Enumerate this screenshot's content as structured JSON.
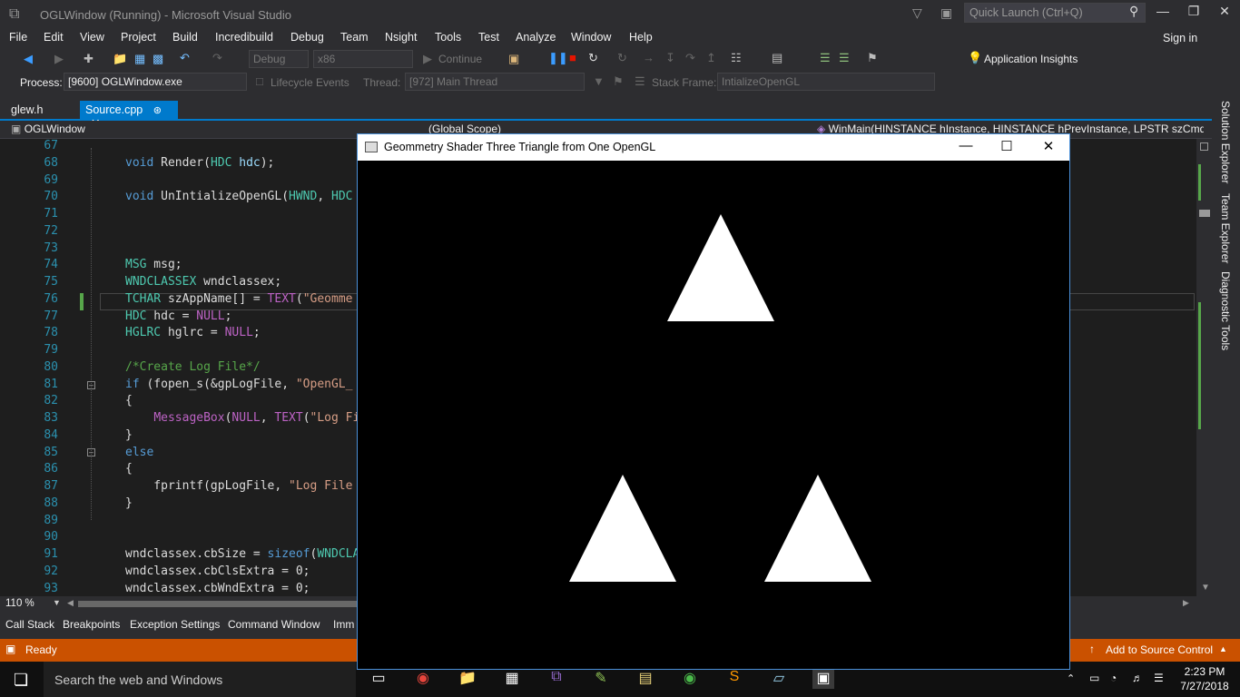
{
  "window": {
    "title": "OGLWindow (Running) - Microsoft Visual Studio",
    "quick_launch_placeholder": "Quick Launch (Ctrl+Q)"
  },
  "menu": [
    "File",
    "Edit",
    "View",
    "Project",
    "Build",
    "Incredibuild",
    "Debug",
    "Team",
    "Nsight",
    "Tools",
    "Test",
    "Analyze",
    "Window",
    "Help"
  ],
  "sign_in": "Sign in",
  "toolbar": {
    "config": "Debug",
    "platform": "x86",
    "continue": "Continue",
    "app_insights": "Application Insights"
  },
  "debug_location": {
    "process_label": "Process:",
    "process": "[9600] OGLWindow.exe",
    "lifecycle": "Lifecycle Events",
    "thread_label": "Thread:",
    "thread": "[972] Main Thread",
    "stack_label": "Stack Frame:",
    "stack": "IntializeOpenGL"
  },
  "tabs": {
    "glew": "glew.h",
    "source": "Source.cpp"
  },
  "navbar": {
    "project": "OGLWindow",
    "scope": "(Global Scope)",
    "member": "WinMain(HINSTANCE hInstance, HINSTANCE hPrevInstance, LPSTR szCmdLi"
  },
  "code_lines": [
    {
      "n": "67",
      "html": ""
    },
    {
      "n": "68",
      "html": "<span class='kw'>void</span> Render(<span class='ty'>HDC</span> <span class='vr'>hdc</span>);"
    },
    {
      "n": "69",
      "html": ""
    },
    {
      "n": "70",
      "html": "<span class='kw'>void</span> UnIntializeOpenGL(<span class='ty'>HWND</span>, <span class='ty'>HDC</span>"
    },
    {
      "n": "71",
      "html": ""
    },
    {
      "n": "72",
      "html": ""
    },
    {
      "n": "73",
      "html": ""
    },
    {
      "n": "74",
      "html": "<span class='ty'>MSG</span> msg;"
    },
    {
      "n": "75",
      "html": "<span class='ty'>WNDCLASSEX</span> wndclassex;"
    },
    {
      "n": "76",
      "html": "<span class='ty'>TCHAR</span> szAppName[] = <span class='mac'>TEXT</span>(<span class='str'>\"Geomme</span>"
    },
    {
      "n": "77",
      "html": "<span class='ty'>HDC</span> hdc = <span class='mac'>NULL</span>;"
    },
    {
      "n": "78",
      "html": "<span class='ty'>HGLRC</span> hglrc = <span class='mac'>NULL</span>;"
    },
    {
      "n": "79",
      "html": ""
    },
    {
      "n": "80",
      "html": "<span class='cm'>/*Create Log File*/</span>"
    },
    {
      "n": "81",
      "html": "<span class='kw'>if</span> (fopen_s(&amp;gpLogFile, <span class='str'>\"OpenGL_</span>"
    },
    {
      "n": "82",
      "html": "{"
    },
    {
      "n": "83",
      "html": "    <span class='mac'>MessageBox</span>(<span class='mac'>NULL</span>, <span class='mac'>TEXT</span>(<span class='str'>\"Log Fi</span>"
    },
    {
      "n": "84",
      "html": "}"
    },
    {
      "n": "85",
      "html": "<span class='kw'>else</span>"
    },
    {
      "n": "86",
      "html": "{"
    },
    {
      "n": "87",
      "html": "    fprintf(gpLogFile, <span class='str'>\"Log File</span>"
    },
    {
      "n": "88",
      "html": "}"
    },
    {
      "n": "89",
      "html": ""
    },
    {
      "n": "90",
      "html": ""
    },
    {
      "n": "91",
      "html": "wndclassex.cbSize = <span class='kw'>sizeof</span>(<span class='ty'>WNDCLA</span>"
    },
    {
      "n": "92",
      "html": "wndclassex.cbClsExtra = 0;"
    },
    {
      "n": "93",
      "html": "wndclassex.cbWndExtra = 0;"
    }
  ],
  "zoom": "110 %",
  "side_tabs": [
    "Solution Explorer",
    "Team Explorer",
    "Diagnostic Tools"
  ],
  "bottom_tabs": [
    "Call Stack",
    "Breakpoints",
    "Exception Settings",
    "Command Window",
    "Imm"
  ],
  "status": {
    "ready": "Ready",
    "source_control": "Add to Source Control"
  },
  "gl_window": {
    "title": "Geommetry Shader Three Triangle from One OpenGL"
  },
  "taskbar": {
    "search": "Search the web and Windows",
    "time": "2:23 PM",
    "date": "7/27/2018"
  }
}
